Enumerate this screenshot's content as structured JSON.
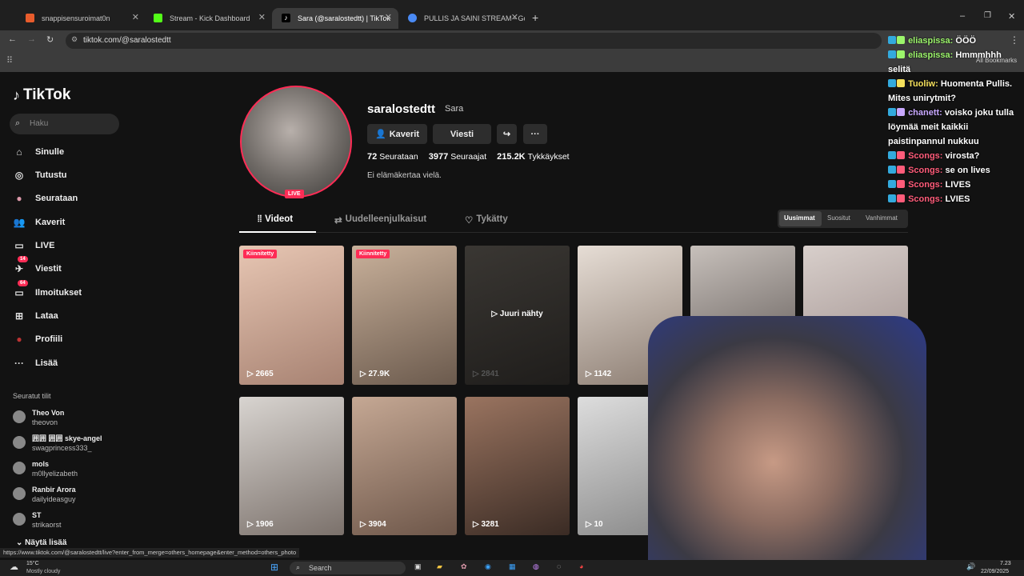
{
  "tabs": [
    {
      "title": "snappisensuroimat0n"
    },
    {
      "title": "Stream - Kick Dashboard"
    },
    {
      "title": "Sara (@saralostedtt) | TikTok"
    },
    {
      "title": "PULLIS JA SAINI STREAM - Goo"
    }
  ],
  "colors": {
    "accent": "#fe2c55",
    "kick": "#53fc18"
  },
  "address": "tiktok.com/@saralostedtt",
  "bookmarks_label": "All Bookmarks",
  "tiktok": {
    "logo": "TikTok",
    "search_placeholder": "Haku",
    "nav": [
      {
        "label": "Sinulle",
        "icon": "home-icon"
      },
      {
        "label": "Tutustu",
        "icon": "compass-icon"
      },
      {
        "label": "Seurataan",
        "icon": "avatar-icon"
      },
      {
        "label": "Kaverit",
        "icon": "friends-icon"
      },
      {
        "label": "LIVE",
        "icon": "live-icon"
      },
      {
        "label": "Viestit",
        "icon": "messages-icon",
        "badge": "14"
      },
      {
        "label": "Ilmoitukset",
        "icon": "inbox-icon",
        "badge": "64"
      },
      {
        "label": "Lataa",
        "icon": "upload-icon"
      },
      {
        "label": "Profiili",
        "icon": "profile-icon"
      },
      {
        "label": "Lisää",
        "icon": "more-icon"
      }
    ],
    "following_title": "Seuratut tilit",
    "following": [
      {
        "name": "Theo Von",
        "handle": "theovon"
      },
      {
        "name": "囲囲 囲囲 skye-angel",
        "handle": "swagprincess333_"
      },
      {
        "name": "mols",
        "handle": "m0llyelizabeth"
      },
      {
        "name": "Ranbir Arora",
        "handle": "dailyideasguy"
      },
      {
        "name": "ST",
        "handle": "strikaorst"
      }
    ],
    "show_more": "Näytä lisää",
    "profile": {
      "username": "saralostedtt",
      "display_name": "Sara",
      "live": "LIVE",
      "btn_friends": "Kaverit",
      "btn_message": "Viesti",
      "following_count": "72",
      "following_label": "Seurataan",
      "followers_count": "3977",
      "followers_label": "Seuraajat",
      "likes_count": "215.2K",
      "likes_label": "Tykkäykset",
      "bio": "Ei elämäkertaa vielä."
    },
    "content_tabs": [
      "Videot",
      "Uudelleenjulkaisut",
      "Tykätty"
    ],
    "sort": [
      "Uusimmat",
      "Suositut",
      "Vanhimmat"
    ],
    "videos": [
      {
        "views": "2665",
        "pinned": "Kiinnitetty"
      },
      {
        "views": "27.9K",
        "pinned": "Kiinnitetty"
      },
      {
        "views": "2841",
        "seen": "Juuri nähty"
      },
      {
        "views": "1142"
      },
      {
        "views": ""
      },
      {
        "views": ""
      },
      {
        "views": "1906"
      },
      {
        "views": "3904"
      },
      {
        "views": "3281"
      },
      {
        "views": "10"
      }
    ]
  },
  "chat": [
    {
      "user": "eliaspissa:",
      "msg": "ÖÖÖ",
      "color": "#9cf56b"
    },
    {
      "user": "eliaspissa:",
      "msg": "Hmmmhhh selitä",
      "color": "#9cf56b"
    },
    {
      "user": "Tuoliw:",
      "msg": "Huomenta Pullis. Mites unirytmit?",
      "color": "#f5e05c"
    },
    {
      "user": "chanett:",
      "msg": "voisko joku tulla löymää meit kaikkii paistinpannul nukkuu",
      "color": "#c8a8ff"
    },
    {
      "user": "Scongs:",
      "msg": "virosta?",
      "color": "#ff5c7a"
    },
    {
      "user": "Scongs:",
      "msg": "se on lives",
      "color": "#ff5c7a"
    },
    {
      "user": "Scongs:",
      "msg": "LIVES",
      "color": "#ff5c7a"
    },
    {
      "user": "Scongs:",
      "msg": "LVIES",
      "color": "#ff5c7a"
    }
  ],
  "status_url": "https://www.tiktok.com/@saralostedtt/live?enter_from_merge=others_homepage&enter_method=others_photo",
  "taskbar": {
    "weather_temp": "15°C",
    "weather_desc": "Mostly cloudy",
    "search": "Search",
    "time": "7.23",
    "date": "22/09/2025"
  }
}
